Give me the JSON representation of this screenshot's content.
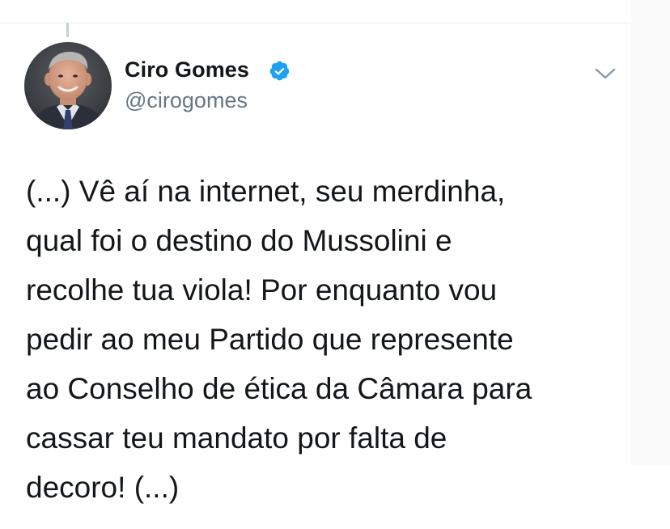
{
  "author": {
    "name": "Ciro Gomes",
    "handle": "@cirogomes",
    "verified": true,
    "avatar_icon": "profile-photo"
  },
  "icons": {
    "verified": "verified-badge-icon",
    "menu": "chevron-down-icon"
  },
  "colors": {
    "verified_blue": "#1da1f2",
    "name_text": "#14171a",
    "handle_text": "#657786",
    "divider": "#e6ecf0"
  },
  "tweet": {
    "lines": [
      "(...) Vê aí na internet, seu merdinha,",
      "qual foi o destino do Mussolini e",
      "recolhe tua viola! Por enquanto vou",
      "pedir ao meu Partido que represente",
      "ao Conselho de ética da Câmara para",
      "cassar teu mandato por falta de",
      "decoro! (...)"
    ]
  }
}
